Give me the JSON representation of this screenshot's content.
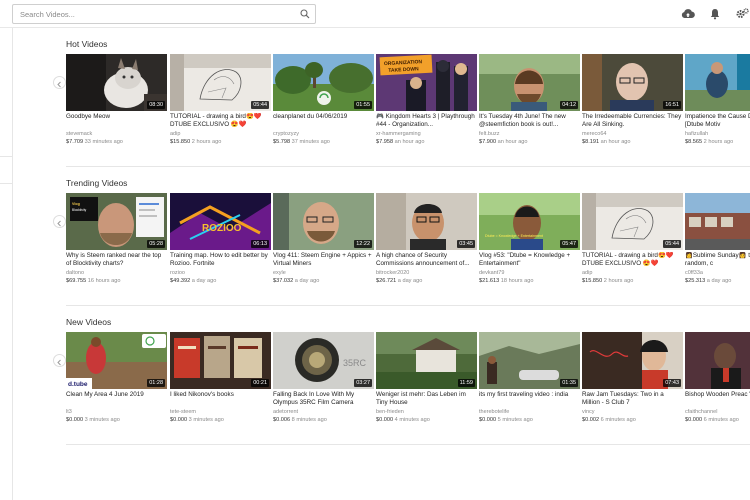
{
  "search": {
    "placeholder": "Search Videos..."
  },
  "sections": [
    {
      "title": "Hot Videos",
      "videos": [
        {
          "title": "Goodbye Meow",
          "author": "stevemack",
          "value": "$7.709",
          "ago": "33 minutes ago",
          "duration": "08:30"
        },
        {
          "title": "TUTORIAL - drawing a bird😍❤️ DTUBE EXCLUSIVO 😍❤️",
          "author": "adip",
          "value": "$15.850",
          "ago": "2 hours ago",
          "duration": "05:44"
        },
        {
          "title": "cleanplanet du 04/06/2019",
          "author": "cryptozyzy",
          "value": "$5.798",
          "ago": "37 minutes ago",
          "duration": "01:55"
        },
        {
          "title": "🎮 Kingdom Hearts 3 | Playthrough #44 - Organization...",
          "author": "xr-hammergaming",
          "value": "$7.958",
          "ago": "an hour ago",
          "duration": ""
        },
        {
          "title": "It's Tuesday 4th June! The new @steemfiction book is out!...",
          "author": "felt.buzz",
          "value": "$7.900",
          "ago": "an hour ago",
          "duration": "04:12"
        },
        {
          "title": "The Irredeemable Currencies: They Are All Sinking.",
          "author": "mereco64",
          "value": "$8.191",
          "ago": "an hour ago",
          "duration": "16:51"
        },
        {
          "title": "Impatience the Cause Downfall [Dtube Motiv",
          "author": "hafizullah",
          "value": "$8.565",
          "ago": "2 hours ago",
          "duration": ""
        }
      ]
    },
    {
      "title": "Trending Videos",
      "videos": [
        {
          "title": "Why is Steem ranked near the top of Blocktivity charts?",
          "author": "daltono",
          "value": "$69.755",
          "ago": "16 hours ago",
          "duration": "05:28"
        },
        {
          "title": "Training map. How to edit better by Rozioo. Fortnite",
          "author": "rozioo",
          "value": "$49.392",
          "ago": "a day ago",
          "duration": "06:13"
        },
        {
          "title": "Vlog 411: Steem Engine + Appics + Virtual Miners",
          "author": "exyle",
          "value": "$37.032",
          "ago": "a day ago",
          "duration": "12:22"
        },
        {
          "title": "A high chance of Security Commissions announcement of...",
          "author": "bitrocker2020",
          "value": "$26.721",
          "ago": "a day ago",
          "duration": "03:45"
        },
        {
          "title": "Vlog #53: \"Dtube = Knowledge + Entertainment\"",
          "author": "devkant79",
          "value": "$21.613",
          "ago": "18 hours ago",
          "duration": "05:47"
        },
        {
          "title": "TUTORIAL - drawing a bird😍❤️ DTUBE EXCLUSIVO 😍❤️",
          "author": "adip",
          "value": "$15.850",
          "ago": "2 hours ago",
          "duration": "05:44"
        },
        {
          "title": "👩Sublime Sunday👩 to post your random, c",
          "author": "c0ff33a",
          "value": "$25.313",
          "ago": "a day ago",
          "duration": ""
        }
      ]
    },
    {
      "title": "New Videos",
      "videos": [
        {
          "title": "Clean My Area 4 June 2019",
          "author": "lt3",
          "value": "$0.000",
          "ago": "3 minutes ago",
          "duration": "01:28"
        },
        {
          "title": "I liked Nikonov's books",
          "author": "tete-steem",
          "value": "$0.000",
          "ago": "3 minutes ago",
          "duration": "00:21"
        },
        {
          "title": "Falling Back In Love With My Olympus 35RC Film Camera",
          "author": "adetorrent",
          "value": "$0.006",
          "ago": "8 minutes ago",
          "duration": "03:27"
        },
        {
          "title": "Weniger ist mehr: Das Leben im Tiny House",
          "author": "ben-frieden",
          "value": "$0.000",
          "ago": "4 minutes ago",
          "duration": "11:59"
        },
        {
          "title": "its my first traveling video : india",
          "author": "therebotelife",
          "value": "$0.000",
          "ago": "5 minutes ago",
          "duration": "01:35"
        },
        {
          "title": "Raw Jam Tuesdays: Two in a Million - S Club 7",
          "author": "vincy",
          "value": "$0.002",
          "ago": "6 minutes ago",
          "duration": "07:43"
        },
        {
          "title": "Bishop Wooden Preac \"Holiness\"",
          "author": "cfaithchannel",
          "value": "$0.000",
          "ago": "6 minutes ago",
          "duration": ""
        }
      ]
    }
  ],
  "thumb_overlays": {
    "organization_banner": "ORGANIZATION TAKE DOWN",
    "blocktivity_tag": "Vlog Blocktivity",
    "dtube_logo": "d.tube",
    "rozioo_tag": "ROZIOO",
    "rc_text": "35RC"
  },
  "colors": {
    "accent_red": "#e00000",
    "text_dark": "#222222",
    "text_muted": "#8a8a8a",
    "divider": "#e6e6e6"
  }
}
